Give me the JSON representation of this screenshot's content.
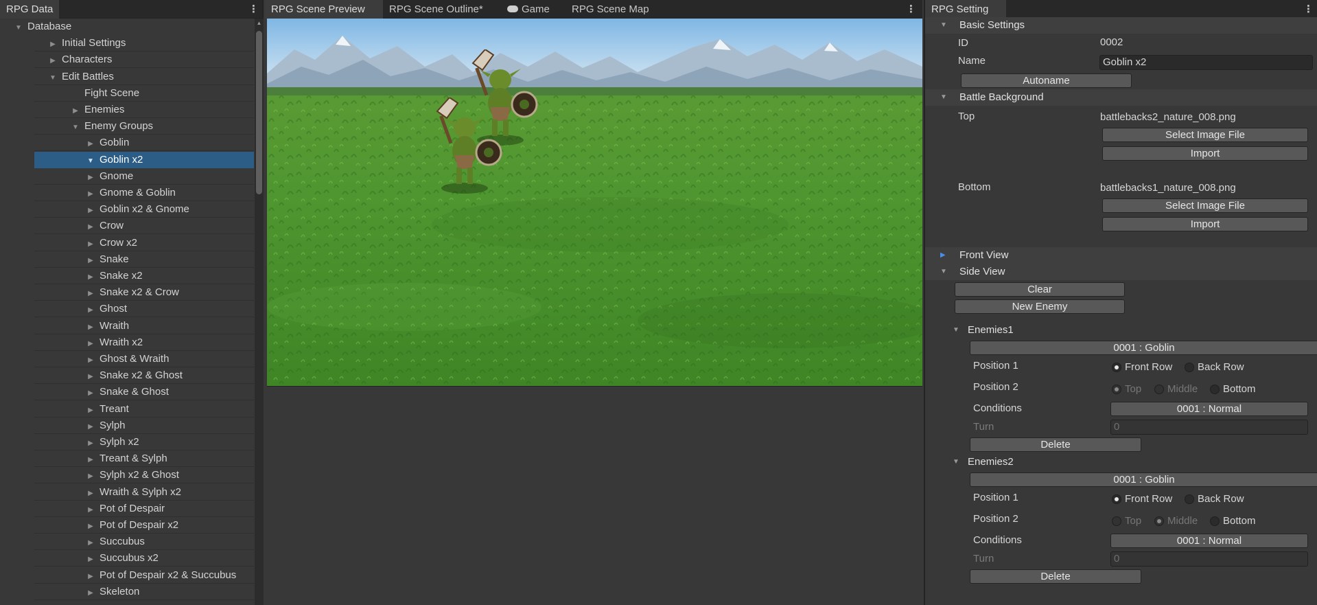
{
  "left_panel": {
    "tab": "RPG Data",
    "tree": [
      {
        "label": "Database",
        "arrow": "▼",
        "indent": 0
      },
      {
        "label": "Initial Settings",
        "arrow": "▶",
        "indent": 1
      },
      {
        "label": "Characters",
        "arrow": "▶",
        "indent": 1
      },
      {
        "label": "Edit Battles",
        "arrow": "▼",
        "indent": 1
      },
      {
        "label": "Fight Scene",
        "arrow": "",
        "indent": 2
      },
      {
        "label": "Enemies",
        "arrow": "▶",
        "indent": 2
      },
      {
        "label": "Enemy Groups",
        "arrow": "▼",
        "indent": 2
      },
      {
        "label": "Goblin",
        "arrow": "▶",
        "indent": 3
      },
      {
        "label": "Goblin x2",
        "arrow": "▼",
        "indent": 3,
        "selected": true
      },
      {
        "label": "Gnome",
        "arrow": "▶",
        "indent": 3
      },
      {
        "label": "Gnome & Goblin",
        "arrow": "▶",
        "indent": 3
      },
      {
        "label": "Goblin x2 & Gnome",
        "arrow": "▶",
        "indent": 3
      },
      {
        "label": "Crow",
        "arrow": "▶",
        "indent": 3
      },
      {
        "label": "Crow x2",
        "arrow": "▶",
        "indent": 3
      },
      {
        "label": "Snake",
        "arrow": "▶",
        "indent": 3
      },
      {
        "label": "Snake x2",
        "arrow": "▶",
        "indent": 3
      },
      {
        "label": "Snake x2 & Crow",
        "arrow": "▶",
        "indent": 3
      },
      {
        "label": "Ghost",
        "arrow": "▶",
        "indent": 3
      },
      {
        "label": "Wraith",
        "arrow": "▶",
        "indent": 3
      },
      {
        "label": "Wraith x2",
        "arrow": "▶",
        "indent": 3
      },
      {
        "label": "Ghost & Wraith",
        "arrow": "▶",
        "indent": 3
      },
      {
        "label": "Snake x2 & Ghost",
        "arrow": "▶",
        "indent": 3
      },
      {
        "label": "Snake & Ghost",
        "arrow": "▶",
        "indent": 3
      },
      {
        "label": "Treant",
        "arrow": "▶",
        "indent": 3
      },
      {
        "label": "Sylph",
        "arrow": "▶",
        "indent": 3
      },
      {
        "label": "Sylph x2",
        "arrow": "▶",
        "indent": 3
      },
      {
        "label": "Treant & Sylph",
        "arrow": "▶",
        "indent": 3
      },
      {
        "label": "Sylph x2 & Ghost",
        "arrow": "▶",
        "indent": 3
      },
      {
        "label": "Wraith & Sylph x2",
        "arrow": "▶",
        "indent": 3
      },
      {
        "label": "Pot of Despair",
        "arrow": "▶",
        "indent": 3
      },
      {
        "label": "Pot of Despair x2",
        "arrow": "▶",
        "indent": 3
      },
      {
        "label": "Succubus",
        "arrow": "▶",
        "indent": 3
      },
      {
        "label": "Succubus x2",
        "arrow": "▶",
        "indent": 3
      },
      {
        "label": "Pot of Despair x2 & Succubus",
        "arrow": "▶",
        "indent": 3
      },
      {
        "label": "Skeleton",
        "arrow": "▶",
        "indent": 3
      }
    ]
  },
  "center_panel": {
    "tabs": [
      {
        "label": "RPG Scene Preview",
        "active": true
      },
      {
        "label": "RPG Scene Outline*",
        "active": false
      },
      {
        "label": "Game",
        "active": false,
        "icon": "gamepad-icon"
      },
      {
        "label": "RPG Scene Map",
        "active": false
      }
    ]
  },
  "right_panel": {
    "tab": "RPG Setting",
    "basic_settings": {
      "title": "Basic Settings",
      "id_label": "ID",
      "id_value": "0002",
      "name_label": "Name",
      "name_value": "Goblin x2",
      "autoname_button": "Autoname"
    },
    "battle_background": {
      "title": "Battle Background",
      "top_label": "Top",
      "top_file": "battlebacks2_nature_008.png",
      "bottom_label": "Bottom",
      "bottom_file": "battlebacks1_nature_008.png",
      "select_button": "Select Image File",
      "import_button": "Import"
    },
    "front_view": {
      "title": "Front View"
    },
    "side_view": {
      "title": "Side View",
      "clear_button": "Clear",
      "new_enemy_button": "New Enemy",
      "enemies": [
        {
          "title": "Enemies1",
          "enemy": "0001 : Goblin",
          "position1_label": "Position 1",
          "position1_options": [
            "Front Row",
            "Back Row"
          ],
          "position1_selected": 0,
          "position2_label": "Position 2",
          "position2_options": [
            "Top",
            "Middle",
            "Bottom"
          ],
          "position2_selected": 0,
          "conditions_label": "Conditions",
          "conditions_value": "0001 : Normal",
          "turn_label": "Turn",
          "turn_value": "0",
          "delete_button": "Delete"
        },
        {
          "title": "Enemies2",
          "enemy": "0001 : Goblin",
          "position1_label": "Position 1",
          "position1_options": [
            "Front Row",
            "Back Row"
          ],
          "position1_selected": 0,
          "position2_label": "Position 2",
          "position2_options": [
            "Top",
            "Middle",
            "Bottom"
          ],
          "position2_selected": 1,
          "conditions_label": "Conditions",
          "conditions_value": "0001 : Normal",
          "turn_label": "Turn",
          "turn_value": "0",
          "delete_button": "Delete"
        }
      ]
    }
  }
}
